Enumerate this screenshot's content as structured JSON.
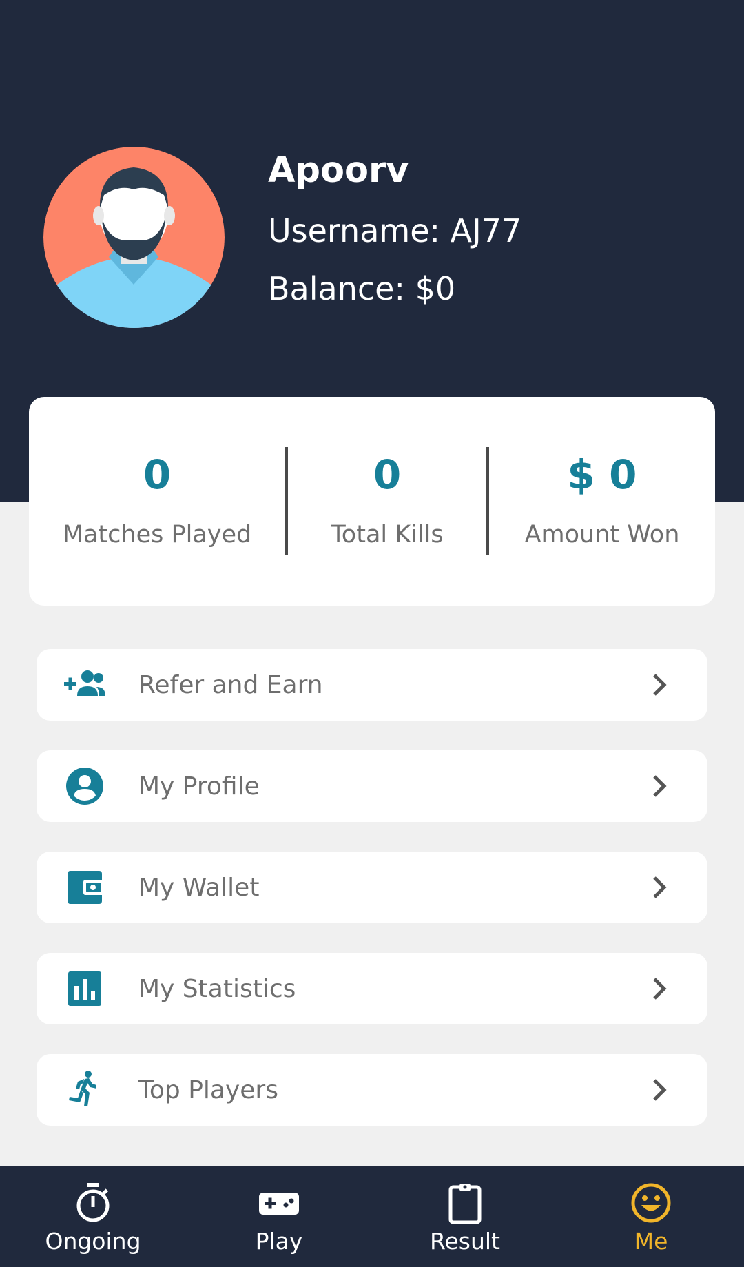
{
  "profile": {
    "name": "Apoorv",
    "username": "Username: AJ77",
    "balance": "Balance: $0"
  },
  "stats": [
    {
      "value": "0",
      "label": "Matches Played"
    },
    {
      "value": "0",
      "label": "Total Kills"
    },
    {
      "value": "$ 0",
      "label": "Amount Won"
    }
  ],
  "menu": [
    {
      "label": "Refer and Earn",
      "icon": "add-group-icon"
    },
    {
      "label": "My Profile",
      "icon": "account-circle-icon"
    },
    {
      "label": "My Wallet",
      "icon": "wallet-icon"
    },
    {
      "label": "My Statistics",
      "icon": "bar-chart-icon"
    },
    {
      "label": "Top Players",
      "icon": "running-person-icon"
    }
  ],
  "nav": [
    {
      "label": "Ongoing",
      "icon": "stopwatch-icon"
    },
    {
      "label": "Play",
      "icon": "gamepad-icon"
    },
    {
      "label": "Result",
      "icon": "clipboard-icon"
    },
    {
      "label": "Me",
      "icon": "smiley-icon",
      "active": true
    }
  ],
  "colors": {
    "header_bg": "#20293d",
    "accent": "#177f98",
    "active_nav": "#f1b52a",
    "page_bg": "#f0f0f0"
  }
}
